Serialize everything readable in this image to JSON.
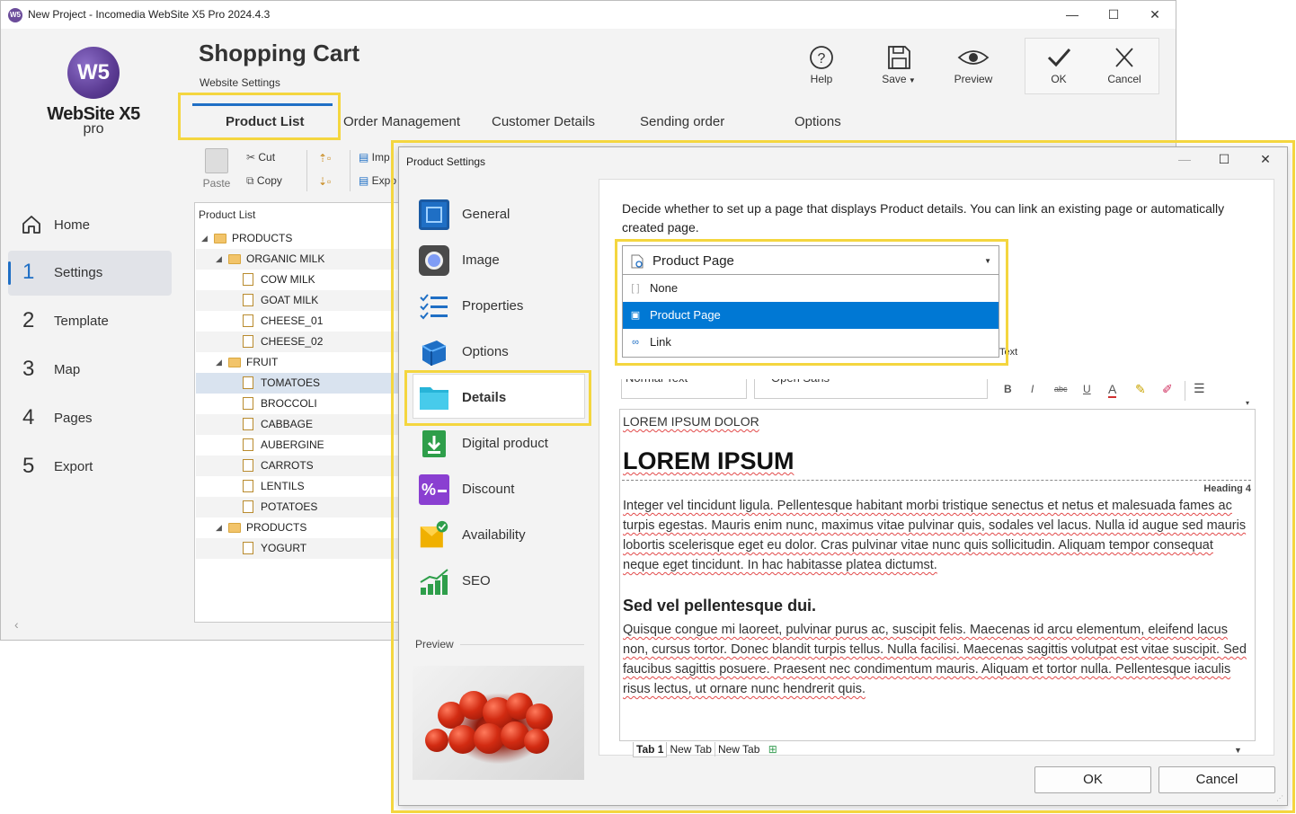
{
  "window": {
    "title": "New Project - Incomedia WebSite X5 Pro 2024.4.3",
    "app_icon": "W5",
    "minimize": "—",
    "maximize": "☐",
    "close": "✕"
  },
  "logo": {
    "mark": "W5",
    "name": "WebSite X5",
    "edition": "pro"
  },
  "sidebar": {
    "items": [
      {
        "num": "",
        "label": "Home",
        "icon": "home-icon"
      },
      {
        "num": "1",
        "label": "Settings"
      },
      {
        "num": "2",
        "label": "Template"
      },
      {
        "num": "3",
        "label": "Map"
      },
      {
        "num": "4",
        "label": "Pages"
      },
      {
        "num": "5",
        "label": "Export"
      }
    ]
  },
  "header": {
    "title": "Shopping Cart",
    "subtitle": "Website Settings",
    "tools": {
      "help": "Help",
      "save": "Save",
      "preview": "Preview",
      "ok": "OK",
      "cancel": "Cancel"
    }
  },
  "tabs": [
    "Product List",
    "Order Management",
    "Customer Details",
    "Sending order",
    "Options"
  ],
  "clipboard": {
    "paste": "Paste",
    "cut": "Cut",
    "copy": "Copy",
    "import": "Imp",
    "export": "Expo"
  },
  "tree": {
    "header": "Product List",
    "rows": [
      {
        "label": "PRODUCTS",
        "type": "folder",
        "level": 0
      },
      {
        "label": "ORGANIC MILK",
        "type": "folder",
        "level": 1
      },
      {
        "label": "COW MILK",
        "type": "file",
        "level": 2
      },
      {
        "label": "GOAT MILK",
        "type": "file",
        "level": 2
      },
      {
        "label": "CHEESE_01",
        "type": "file",
        "level": 2
      },
      {
        "label": "CHEESE_02",
        "type": "file",
        "level": 2
      },
      {
        "label": "FRUIT",
        "type": "folder",
        "level": 1
      },
      {
        "label": "TOMATOES",
        "type": "file",
        "level": 2,
        "selected": true
      },
      {
        "label": "BROCCOLI",
        "type": "file",
        "level": 2
      },
      {
        "label": "CABBAGE",
        "type": "file",
        "level": 2
      },
      {
        "label": "AUBERGINE",
        "type": "file",
        "level": 2
      },
      {
        "label": "CARROTS",
        "type": "file",
        "level": 2
      },
      {
        "label": "LENTILS",
        "type": "file",
        "level": 2
      },
      {
        "label": "POTATOES",
        "type": "file",
        "level": 2
      },
      {
        "label": "PRODUCTS",
        "type": "folder",
        "level": 1
      },
      {
        "label": "YOGURT",
        "type": "file",
        "level": 2
      }
    ]
  },
  "dialog": {
    "title": "Product Settings",
    "categories": [
      {
        "label": "General",
        "icon": "general-icon",
        "color": "#1f6fc5"
      },
      {
        "label": "Image",
        "icon": "camera-icon",
        "color": "#4a4a4a"
      },
      {
        "label": "Properties",
        "icon": "list-icon",
        "color": "#1f6fc5"
      },
      {
        "label": "Options",
        "icon": "cube-icon",
        "color": "#1f6fc5"
      },
      {
        "label": "Details",
        "icon": "folder-icon",
        "color": "#27b4d8"
      },
      {
        "label": "Digital product",
        "icon": "download-icon",
        "color": "#2e9e4a"
      },
      {
        "label": "Discount",
        "icon": "percent-icon",
        "color": "#8a3fd1"
      },
      {
        "label": "Availability",
        "icon": "availability-icon",
        "color": "#f0b000"
      },
      {
        "label": "SEO",
        "icon": "seo-chart-icon",
        "color": "#2e9e4a"
      }
    ],
    "preview_label": "Preview",
    "description": "Decide whether to set up a page that displays Product details. You can link an existing page or automatically created page.",
    "dropdown": {
      "selected": "Product Page",
      "options": [
        {
          "label": "None",
          "icon": "none-icon"
        },
        {
          "label": "Product Page",
          "icon": "page-icon",
          "selected": true
        },
        {
          "label": "Link",
          "icon": "link-icon"
        }
      ]
    },
    "editor_toolbar": {
      "style": "Normal Text",
      "font": "Open Sans",
      "text_label": "Text"
    },
    "editor": {
      "small_heading": "LOREM IPSUM DOLOR",
      "h1": "LOREM IPSUM",
      "heading_tag": "Heading 4",
      "p1": "Integer vel tincidunt ligula. Pellentesque habitant morbi tristique senectus et netus et malesuada fames ac turpis egestas. Mauris enim nunc, maximus vitae pulvinar quis, sodales vel lacus. Nulla id augue sed mauris lobortis scelerisque eget eu dolor. Cras pulvinar vitae nunc quis sollicitudin. Aliquam tempor consequat neque eget tincidunt. In hac habitasse platea dictumst.",
      "h2": "Sed vel pellentesque dui.",
      "p2": "Quisque congue mi laoreet, pulvinar purus ac, suscipit felis. Maecenas id arcu elementum, eleifend lacus non, cursus tortor. Donec blandit turpis tellus. Nulla facilisi. Maecenas sagittis volutpat est vitae suscipit. Sed faucibus sagittis posuere. Praesent nec condimentum mauris. Aliquam et tortor nulla. Pellentesque iaculis risus lectus, ut ornare nunc hendrerit quis."
    },
    "tabs": [
      "Tab 1",
      "New Tab",
      "New Tab"
    ],
    "ok": "OK",
    "cancel": "Cancel"
  },
  "colors": {
    "accent": "#1f6fc5",
    "highlight": "#f4d63f",
    "selection": "#0078d4"
  }
}
